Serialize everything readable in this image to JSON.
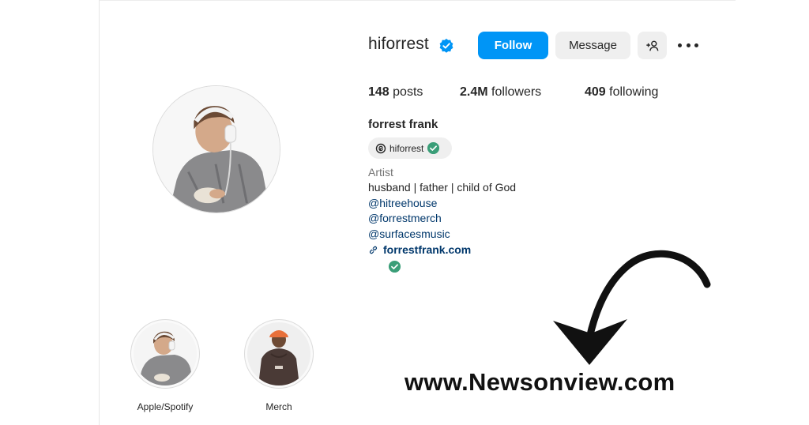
{
  "profile": {
    "username": "hiforrest",
    "verified": true,
    "full_name": "forrest frank",
    "threads_handle": "hiforrest",
    "category": "Artist",
    "bio_lines": [
      "husband | father | child of God"
    ],
    "bio_mentions": [
      "@hitreehouse",
      "@forrestmerch",
      "@surfacesmusic"
    ],
    "website": "forrestfrank.com"
  },
  "actions": {
    "follow_label": "Follow",
    "message_label": "Message",
    "add_user_icon": "add-user-icon",
    "more_icon": "more-horizontal-icon"
  },
  "stats": {
    "posts_count": "148",
    "posts_label": "posts",
    "followers_count": "2.4M",
    "followers_label": "followers",
    "following_count": "409",
    "following_label": "following"
  },
  "highlights": [
    {
      "label": "Apple/Spotify"
    },
    {
      "label": "Merch"
    }
  ],
  "overlay": {
    "watermark": "www.Newsonview.com"
  },
  "colors": {
    "follow_blue": "#0095f6",
    "verified_blue": "#0095f6",
    "secondary_button": "#efefef",
    "link": "#00376b",
    "threads_verified_green": "#3a9e78"
  }
}
